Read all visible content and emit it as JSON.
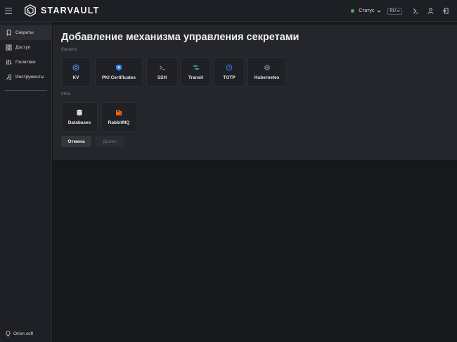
{
  "app": {
    "logo_text": "STARVAULT"
  },
  "header": {
    "status_label": "Статус",
    "status_color": "#4caf50",
    "language": "RU",
    "icons": [
      "terminal-icon",
      "user-icon",
      "logout-icon"
    ]
  },
  "sidebar": {
    "items": [
      {
        "label": "Секреты",
        "icon": "bookmark-icon",
        "active": true
      },
      {
        "label": "Доступ",
        "icon": "grid-icon",
        "active": false
      },
      {
        "label": "Политики",
        "icon": "sliders-icon",
        "active": false
      },
      {
        "label": "Инструменты",
        "icon": "tools-icon",
        "active": false
      }
    ],
    "footer": "Orion soft"
  },
  "main": {
    "title": "Добавление механизма управления секретами",
    "sections": [
      {
        "label": "Generic",
        "engines": [
          {
            "label": "KV",
            "icon": "kv-icon"
          },
          {
            "label": "PKI Certificates",
            "icon": "certificate-shield-icon"
          },
          {
            "label": "SSH",
            "icon": "terminal-prompt-icon"
          },
          {
            "label": "Transit",
            "icon": "transit-icon"
          },
          {
            "label": "TOTP",
            "icon": "clock-icon"
          },
          {
            "label": "Kubernetes",
            "icon": "kubernetes-icon"
          }
        ]
      },
      {
        "label": "Infra",
        "engines": [
          {
            "label": "Databases",
            "icon": "database-icon"
          },
          {
            "label": "RabbitMQ",
            "icon": "rabbitmq-icon"
          }
        ]
      }
    ],
    "buttons": {
      "cancel": "Отмена",
      "next": "Далее"
    }
  },
  "colors": {
    "accent_blue": "#3b82f6",
    "rabbitmq_orange": "#ff6600",
    "transit_green": "#2bb673"
  }
}
